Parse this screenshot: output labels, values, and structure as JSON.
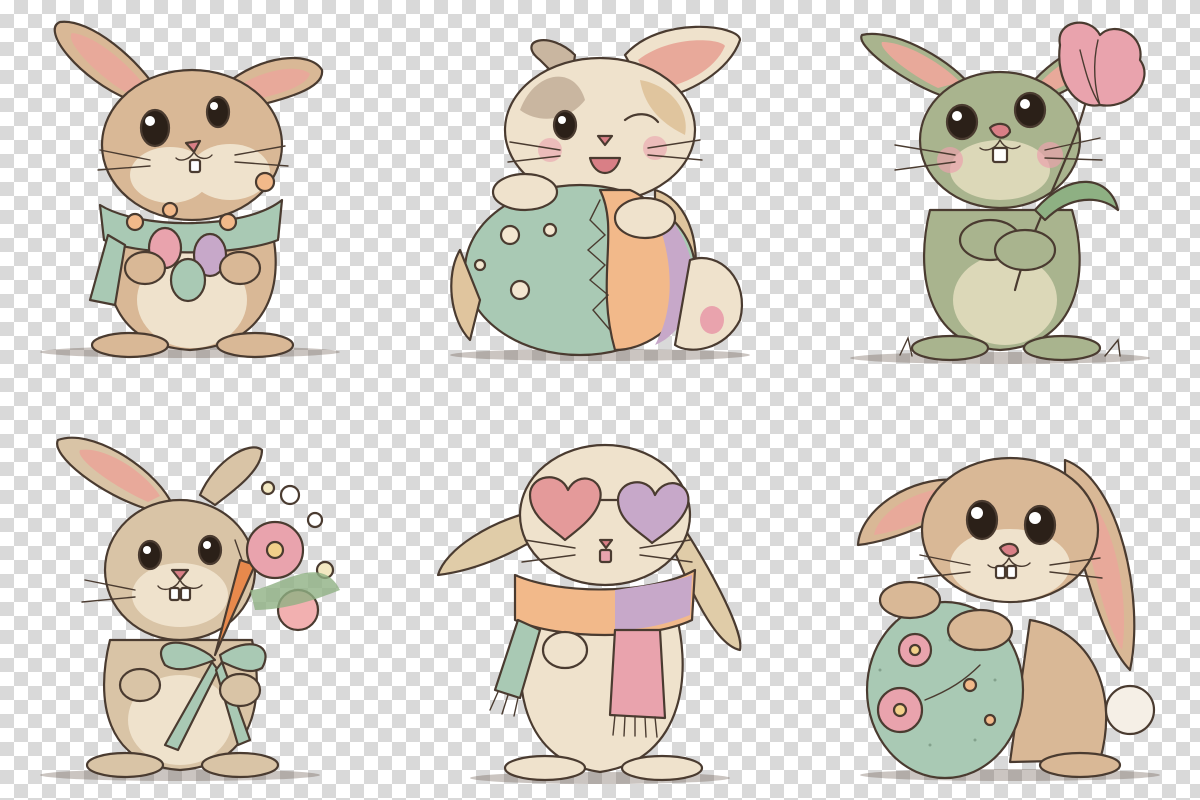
{
  "palette": {
    "fur_tan": "#d9b896",
    "fur_cream": "#efe2cc",
    "fur_green": "#a9b48e",
    "inner_ear": "#e8a99a",
    "mint": "#a9c9b4",
    "peach": "#f2b98a",
    "lavender": "#c7a8c9",
    "pink": "#e9a3ad",
    "ink": "#4a3b30"
  },
  "illustrations": [
    {
      "id": "bunny-scarf-eggs",
      "icon": "bunny-with-mint-scarf-holding-eggs"
    },
    {
      "id": "bunny-big-egg",
      "icon": "winking-bunny-leaning-on-striped-egg"
    },
    {
      "id": "bunny-tulip",
      "icon": "green-bunny-holding-tulip"
    },
    {
      "id": "bunny-bouquet",
      "icon": "bunny-holding-flower-bouquet-and-carrot"
    },
    {
      "id": "bunny-heart-glasses",
      "icon": "bunny-with-heart-sunglasses-and-scarf"
    },
    {
      "id": "bunny-hug-egg",
      "icon": "bunny-hugging-floral-egg"
    }
  ]
}
